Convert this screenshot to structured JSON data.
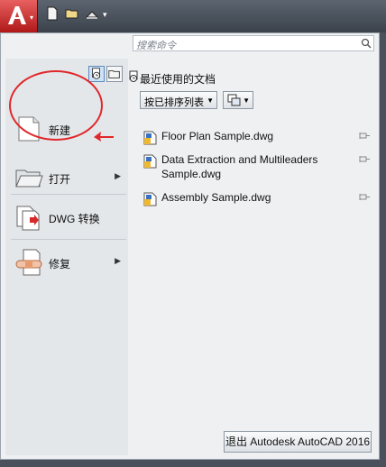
{
  "app": {
    "menu_caret": "▾"
  },
  "search": {
    "placeholder": "搜索命令"
  },
  "left_menu": [
    {
      "label": "新建",
      "icon": "new-document-icon",
      "has_submenu": false
    },
    {
      "label": "打开",
      "icon": "open-folder-icon",
      "has_submenu": true
    },
    {
      "label": "DWG 转换",
      "icon": "dwg-convert-icon",
      "has_submenu": false
    },
    {
      "label": "修复",
      "icon": "repair-icon",
      "has_submenu": true
    }
  ],
  "recent": {
    "title": "最近使用的文档",
    "sort_label": "按已排序列表",
    "documents": [
      {
        "name": "Floor Plan Sample.dwg"
      },
      {
        "name": "Data Extraction and Multileaders Sample.dwg"
      },
      {
        "name": "Assembly Sample.dwg"
      }
    ]
  },
  "exit_button": "退出 Autodesk AutoCAD 2016",
  "colors": {
    "accent": "#e0282b",
    "panel_bg": "#eef0f2",
    "titlebar": "#4a515c"
  }
}
